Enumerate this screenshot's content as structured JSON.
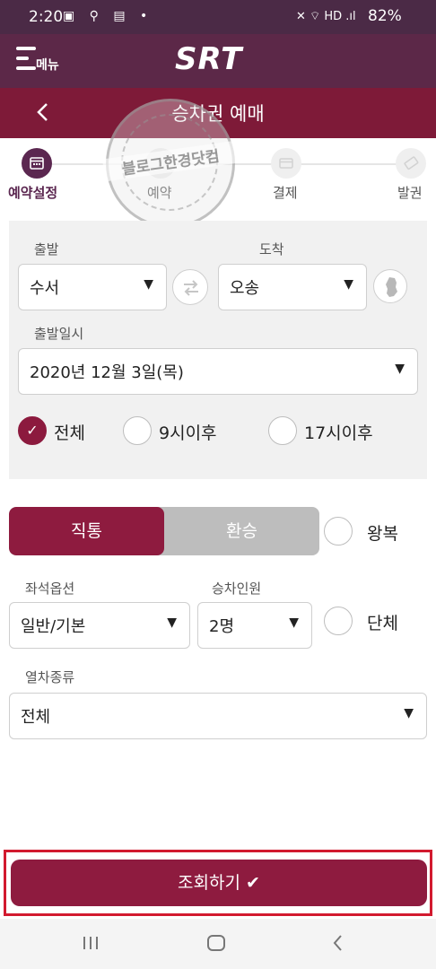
{
  "status_bar": {
    "time": "2:20",
    "left_icons": "▣ ⚲ ▤ •",
    "right_icons": "✕ ⌔ HD .ıl",
    "battery": "82%"
  },
  "header": {
    "menu_label": "메뉴",
    "logo": "SRT",
    "title": "승차권 예매"
  },
  "steps": [
    {
      "label": "예약설정",
      "active": true
    },
    {
      "label": "예약",
      "active": false
    },
    {
      "label": "결제",
      "active": false
    },
    {
      "label": "발권",
      "active": false
    }
  ],
  "watermark": {
    "text": "블로그한경닷컴"
  },
  "route": {
    "departure_label": "출발",
    "departure_value": "수서",
    "arrival_label": "도착",
    "arrival_value": "오송",
    "date_label": "출발일시",
    "date_value": "2020년 12월 3일(목)",
    "time_options": [
      {
        "label": "전체",
        "selected": true
      },
      {
        "label": "9시이후",
        "selected": false
      },
      {
        "label": "17시이후",
        "selected": false
      }
    ]
  },
  "trip": {
    "direct": "직통",
    "transfer": "환승",
    "selected": "직통",
    "round_trip_label": "왕복"
  },
  "seat": {
    "label": "좌석옵션",
    "value": "일반/기본"
  },
  "passengers": {
    "label": "승차인원",
    "value": "2명",
    "group_label": "단체"
  },
  "train_type": {
    "label": "열차종류",
    "value": "전체"
  },
  "search_button": {
    "label": "조회하기 ✔"
  },
  "colors": {
    "brand": "#8e1b3f",
    "header": "#5c2848",
    "titlebar": "#7e1a38",
    "highlight": "#d21a2f"
  }
}
